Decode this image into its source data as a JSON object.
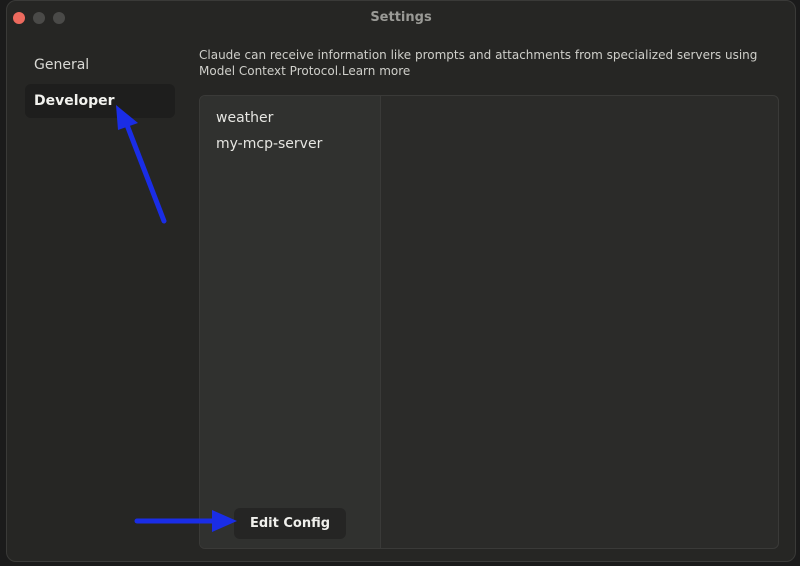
{
  "window": {
    "title": "Settings"
  },
  "sidebar": {
    "items": [
      {
        "label": "General",
        "active": false
      },
      {
        "label": "Developer",
        "active": true
      }
    ]
  },
  "description": {
    "text": "Claude can receive information like prompts and attachments from specialized servers using Model Context Protocol.",
    "link_label": "Learn more"
  },
  "servers": {
    "items": [
      {
        "label": "weather"
      },
      {
        "label": "my-mcp-server"
      }
    ],
    "edit_config_label": "Edit Config"
  },
  "colors": {
    "annotation_arrow": "#1a2de6",
    "close_button": "#ed6a5e"
  },
  "icons": {
    "annotation": "arrow-icon"
  }
}
